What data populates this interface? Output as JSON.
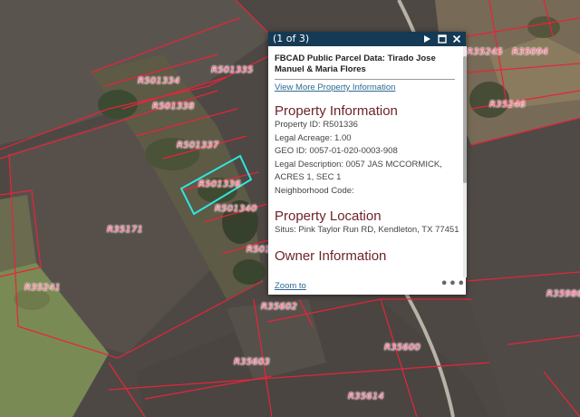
{
  "map": {
    "parcel_labels": [
      "R501335",
      "R501334",
      "R501338",
      "R501337",
      "R501336",
      "R501340",
      "R35171",
      "R35241",
      "R35245",
      "R35094",
      "R35246",
      "R501",
      "R35602",
      "R35600",
      "R35603",
      "R35614",
      "R35986"
    ]
  },
  "popup": {
    "counter": "(1 of 3)",
    "title": "FBCAD Public Parcel Data: Tirado Jose Manuel & Maria Flores",
    "more_link": "View More Property Information",
    "property_info_heading": "Property Information",
    "property_id": "Property ID: R501336",
    "legal_acreage": "Legal Acreage: 1.00",
    "geo_id": "GEO ID: 0057-01-020-0003-908",
    "legal_description": "Legal Description: 0057 JAS MCCORMICK, ACRES 1, SEC 1",
    "neighborhood_code": "Neighborhood Code:",
    "property_location_heading": "Property Location",
    "situs": "Situs: Pink Taylor Run RD, Kendleton, TX 77451",
    "owner_info_heading": "Owner Information",
    "zoom_link": "Zoom to",
    "more_dots": "•••"
  },
  "icons": {
    "next": "play-icon",
    "maximize": "maximize-icon",
    "close": "close-icon"
  },
  "colors": {
    "header": "#153a55",
    "heading": "#6e2327",
    "link": "#2b6a92",
    "parcel_line": "#e8243a",
    "selection": "#2fe6e0"
  }
}
